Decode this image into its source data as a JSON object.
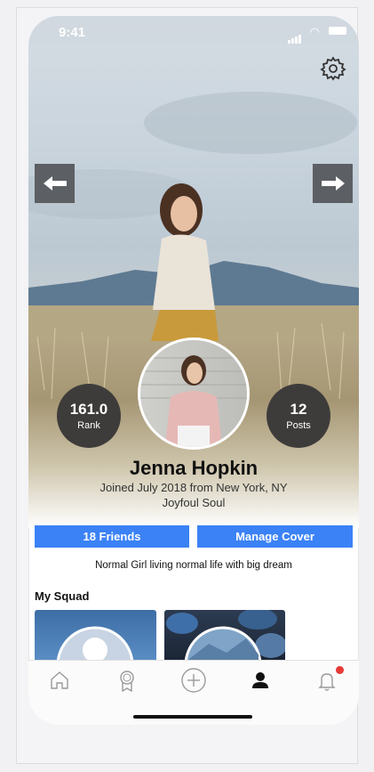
{
  "status_bar": {
    "time": "9:41"
  },
  "profile": {
    "name": "Jenna Hopkin",
    "joined": "Joined July 2018 from New York, NY",
    "tagline": "Joyfoul Soul",
    "bio": "Normal Girl living normal life with big dream"
  },
  "stats": {
    "rank": {
      "value": "161.0",
      "label": "Rank"
    },
    "posts": {
      "value": "12",
      "label": "Posts"
    }
  },
  "buttons": {
    "friends": "18 Friends",
    "manage_cover": "Manage Cover"
  },
  "squad": {
    "title": "My Squad"
  },
  "tab_bar": {
    "items": [
      "home-icon",
      "badge-icon",
      "add-icon",
      "profile-icon",
      "bell-icon"
    ],
    "active": "profile-icon",
    "notification_color": "#e53935"
  },
  "colors": {
    "accent": "#3b82f6",
    "stat_bg": "#3e3c3b",
    "arrow_bg": "#5c5f63"
  }
}
